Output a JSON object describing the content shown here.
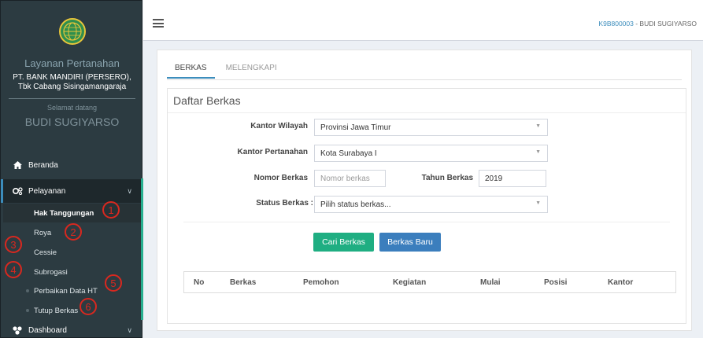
{
  "sidebar": {
    "app_title": "Layanan Pertanahan",
    "bank_name_line1": "PT. BANK MANDIRI (PERSERO),",
    "bank_name_line2": "Tbk Cabang Sisingamangaraja",
    "welcome": "Selamat datang",
    "user_name": "BUDI SUGIYARSO",
    "nav": {
      "beranda": "Beranda",
      "pelayanan": "Pelayanan",
      "dashboard": "Dashboard"
    },
    "submenu": [
      {
        "label": "Hak Tanggungan",
        "marker": "1"
      },
      {
        "label": "Roya",
        "marker": "2"
      },
      {
        "label": "Cessie",
        "marker": "3"
      },
      {
        "label": "Subrogasi",
        "marker": "4"
      },
      {
        "label": "Perbaikan Data HT",
        "marker": "5"
      },
      {
        "label": "Tutup Berkas",
        "marker": "6"
      }
    ]
  },
  "topbar": {
    "user_code": "K9B800003",
    "user_separator": " - ",
    "user_name": "BUDI SUGIYARSO"
  },
  "tabs": [
    "BERKAS",
    "MELENGKAPI"
  ],
  "panel": {
    "title": "Daftar Berkas",
    "labels": {
      "kantor_wilayah": "Kantor Wilayah",
      "kantor_pertanahan": "Kantor Pertanahan",
      "nomor_berkas": "Nomor Berkas",
      "tahun_berkas": "Tahun Berkas",
      "status_berkas": "Status Berkas :"
    },
    "values": {
      "kantor_wilayah": "Provinsi Jawa Timur",
      "kantor_pertanahan": "Kota Surabaya I",
      "nomor_berkas_placeholder": "Nomor berkas",
      "tahun_berkas": "2019",
      "status_berkas_placeholder": "Pilih status berkas..."
    },
    "buttons": {
      "cari": "Cari Berkas",
      "baru": "Berkas Baru"
    },
    "table_headers": [
      "No",
      "Berkas",
      "Pemohon",
      "Kegiatan",
      "Mulai",
      "Posisi",
      "Kantor"
    ]
  },
  "colors": {
    "sidebar_bg": "#2c3b41",
    "accent_blue": "#3c8dbc",
    "btn_green": "#1fae82",
    "btn_blue": "#3b7ebd",
    "marker_red": "#d9281f"
  }
}
